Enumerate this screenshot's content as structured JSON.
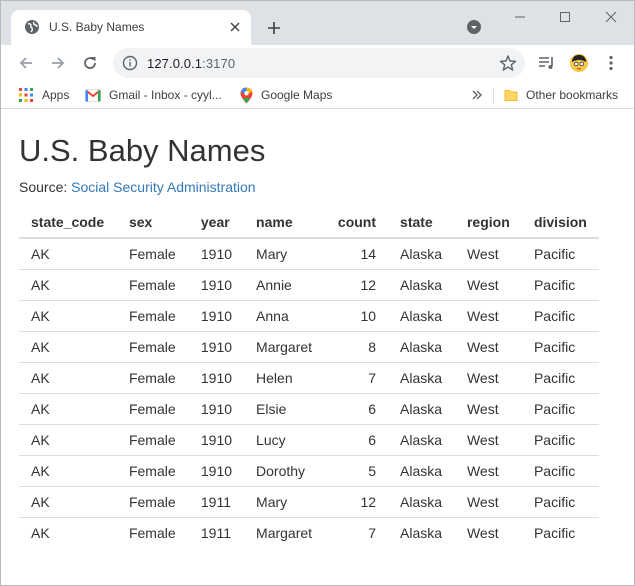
{
  "browser": {
    "tab_title": "U.S. Baby Names",
    "url_host": "127.0.0.1",
    "url_port": ":3170",
    "bookmarks": [
      {
        "label": "Apps",
        "icon": "apps-grid-icon"
      },
      {
        "label": "Gmail - Inbox - cyyl...",
        "icon": "gmail-icon"
      },
      {
        "label": "Google Maps",
        "icon": "maps-pin-icon"
      }
    ],
    "other_bookmarks": "Other bookmarks",
    "colors": {
      "tabstrip": "#dee1e6",
      "omnibox": "#f1f3f4",
      "link": "#337ab7"
    }
  },
  "page": {
    "title": "U.S. Baby Names",
    "source_prefix": "Source: ",
    "source_link": "Social Security Administration"
  },
  "table": {
    "columns": [
      "state_code",
      "sex",
      "year",
      "name",
      "count",
      "state",
      "region",
      "division"
    ],
    "rows": [
      [
        "AK",
        "Female",
        "1910",
        "Mary",
        "14",
        "Alaska",
        "West",
        "Pacific"
      ],
      [
        "AK",
        "Female",
        "1910",
        "Annie",
        "12",
        "Alaska",
        "West",
        "Pacific"
      ],
      [
        "AK",
        "Female",
        "1910",
        "Anna",
        "10",
        "Alaska",
        "West",
        "Pacific"
      ],
      [
        "AK",
        "Female",
        "1910",
        "Margaret",
        "8",
        "Alaska",
        "West",
        "Pacific"
      ],
      [
        "AK",
        "Female",
        "1910",
        "Helen",
        "7",
        "Alaska",
        "West",
        "Pacific"
      ],
      [
        "AK",
        "Female",
        "1910",
        "Elsie",
        "6",
        "Alaska",
        "West",
        "Pacific"
      ],
      [
        "AK",
        "Female",
        "1910",
        "Lucy",
        "6",
        "Alaska",
        "West",
        "Pacific"
      ],
      [
        "AK",
        "Female",
        "1910",
        "Dorothy",
        "5",
        "Alaska",
        "West",
        "Pacific"
      ],
      [
        "AK",
        "Female",
        "1911",
        "Mary",
        "12",
        "Alaska",
        "West",
        "Pacific"
      ],
      [
        "AK",
        "Female",
        "1911",
        "Margaret",
        "7",
        "Alaska",
        "West",
        "Pacific"
      ]
    ]
  }
}
